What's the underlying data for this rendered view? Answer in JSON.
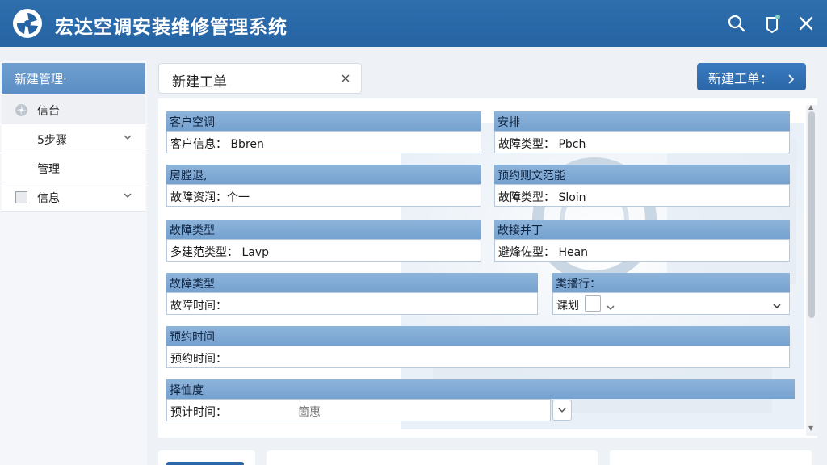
{
  "app": {
    "title": "宏达空调安装维修管理系统"
  },
  "header_icons": [
    "search-icon",
    "notification-icon",
    "close-icon"
  ],
  "sidebar": {
    "head": "新建管理·",
    "items": [
      {
        "label": "信台",
        "icon": "fan-icon"
      },
      {
        "label": "5步骤",
        "chevron": true
      },
      {
        "label": "管理"
      },
      {
        "label": "信息",
        "icon": "checkbox-icon",
        "chevron": true
      }
    ]
  },
  "tab": {
    "label": "新建工单"
  },
  "new_button": {
    "label": "新建工单："
  },
  "form": {
    "g1": {
      "title": "客户空调",
      "value": "客户信息： Bbren"
    },
    "g2": {
      "title": "安排",
      "value": "故障类型： Pbch"
    },
    "g3": {
      "title": "房膛退,",
      "value": "故障资润：个一"
    },
    "g4": {
      "title": "预约则文范能",
      "value": "故障类型： Sloin"
    },
    "g5": {
      "title": "故障类型",
      "value": "多建范类型： Lavp"
    },
    "g6": {
      "title": "故接并丁",
      "value": "避烽佐型： Hean"
    },
    "g7": {
      "title": "故障类型",
      "value": "故障时间："
    },
    "g8": {
      "title": "类播行：",
      "value": "课划"
    },
    "g9": {
      "title": "预约时间",
      "value": "预约时间："
    },
    "g10": {
      "title": "择恤度",
      "value": "预计时间：",
      "extra": "箇惠"
    }
  },
  "colors": {
    "header": "#2563a3",
    "accent": "#75a2d0",
    "button": "#2a66a8"
  }
}
